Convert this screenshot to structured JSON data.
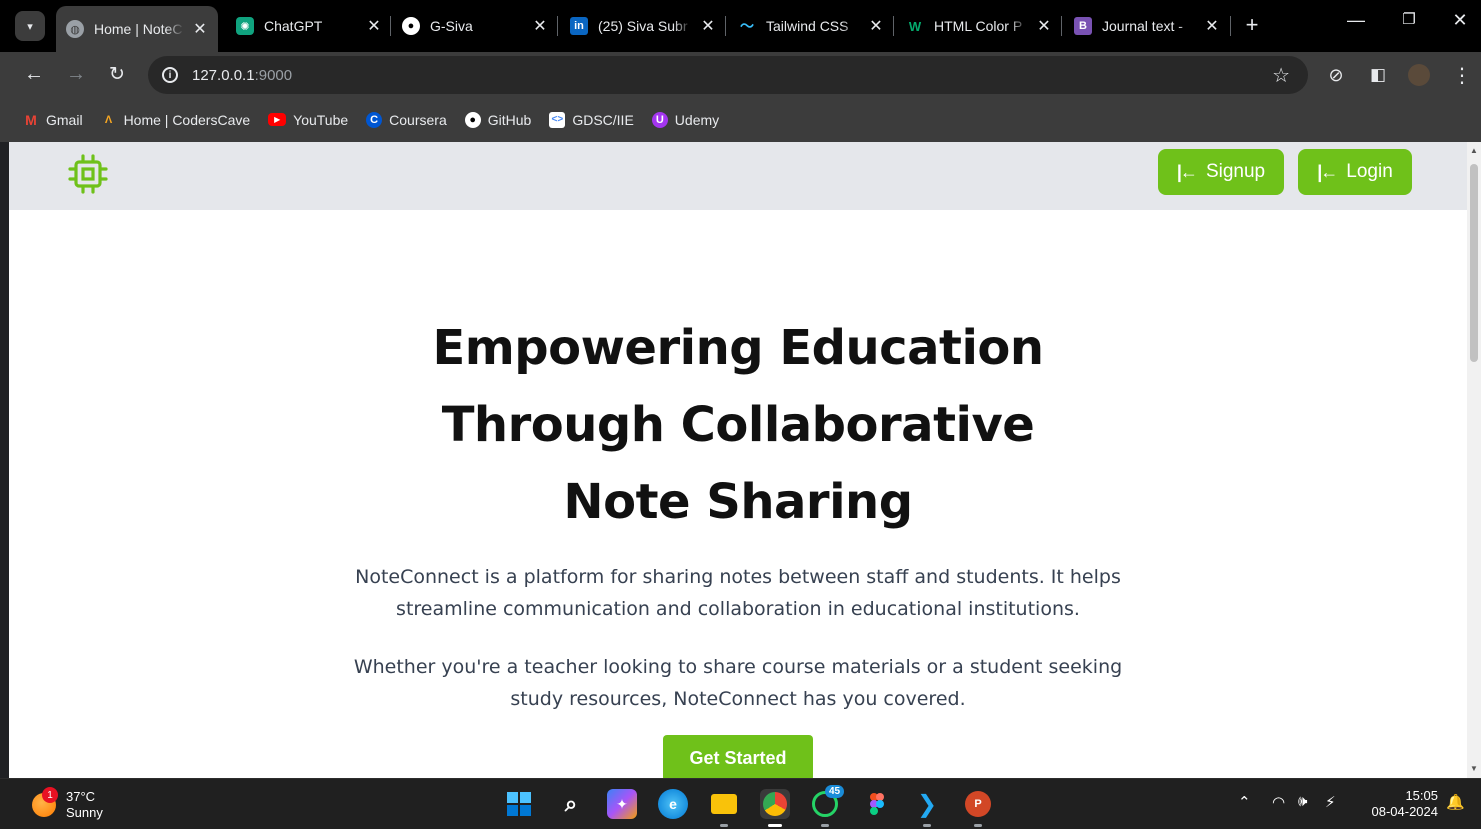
{
  "browser": {
    "tabs": [
      {
        "title": "Home | NoteC",
        "active": true,
        "icon": "globe-icon"
      },
      {
        "title": "ChatGPT",
        "icon": "chatgpt-icon"
      },
      {
        "title": "G-Siva",
        "icon": "github-icon"
      },
      {
        "title": "(25) Siva Subr",
        "icon": "linkedin-icon"
      },
      {
        "title": "Tailwind CSS",
        "icon": "tailwind-icon"
      },
      {
        "title": "HTML Color P",
        "icon": "w3-icon"
      },
      {
        "title": "Journal text -",
        "icon": "bootstrap-icon"
      }
    ],
    "url_host": "127.0.0.1",
    "url_port": ":9000",
    "bookmarks": [
      {
        "label": "Gmail",
        "icon": "gmail-icon"
      },
      {
        "label": "Home | CodersCave",
        "icon": "coderscave-icon"
      },
      {
        "label": "YouTube",
        "icon": "youtube-icon"
      },
      {
        "label": "Coursera",
        "icon": "coursera-icon"
      },
      {
        "label": "GitHub",
        "icon": "github-icon"
      },
      {
        "label": "GDSC/IIE",
        "icon": "gdsc-icon"
      },
      {
        "label": "Udemy",
        "icon": "udemy-icon"
      }
    ]
  },
  "site": {
    "signup_label": "Signup",
    "login_label": "Login",
    "hero_title": "Empowering Education Through Collaborative Note Sharing",
    "para1": "NoteConnect is a platform for sharing notes between staff and students. It helps streamline communication and collaboration in educational institutions.",
    "para2": "Whether you're a teacher looking to share course materials or a student seeking study resources, NoteConnect has you covered.",
    "cta_label": "Get Started",
    "accent_color": "#6fc11a"
  },
  "taskbar": {
    "weather_badge": "1",
    "temperature": "37°C",
    "condition": "Sunny",
    "whatsapp_badge": "45",
    "time": "15:05",
    "date": "08-04-2024"
  }
}
